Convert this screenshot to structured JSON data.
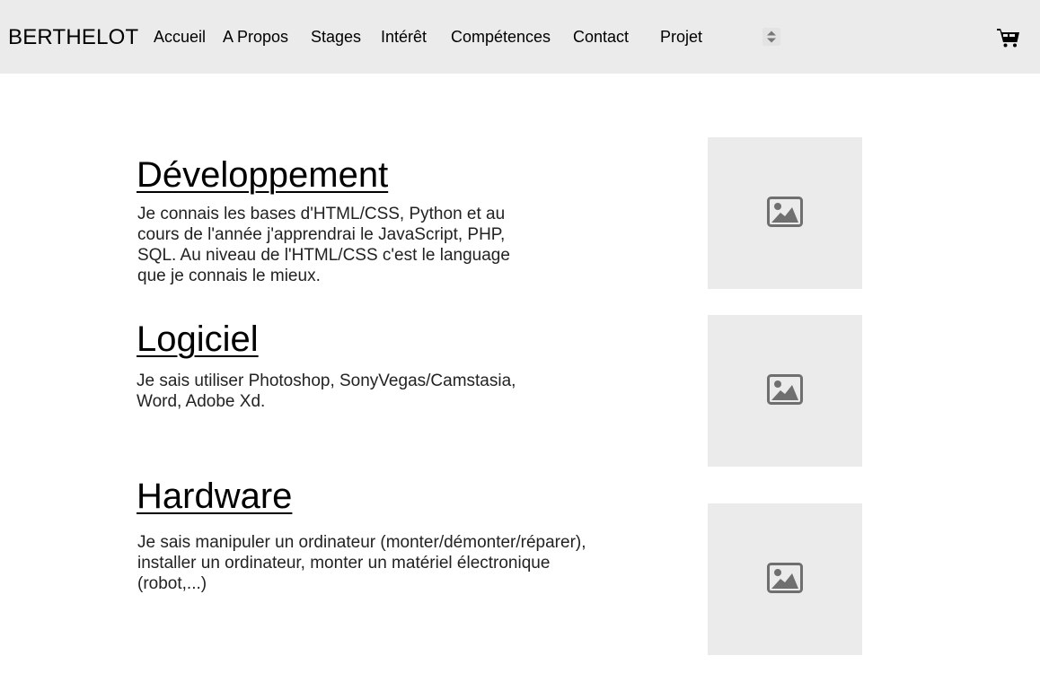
{
  "navbar": {
    "brand": "BERTHELOT",
    "links": [
      "Accueil",
      "A Propos",
      "Stages",
      "Intérêt",
      "Compétences",
      "Contact",
      "Projet"
    ],
    "select_icon": "up-down-arrows-icon",
    "cart_icon": "cart-icon"
  },
  "sections": [
    {
      "title": "Développement",
      "text": "Je connais les bases d'HTML/CSS, Python et au cours de l'année j'apprendrai le JavaScript, PHP, SQL. Au niveau de l'HTML/CSS c'est le language que je connais le mieux.",
      "image_icon": "image-placeholder-icon"
    },
    {
      "title": "Logiciel",
      "text": "Je sais utiliser Photoshop, SonyVegas/Camstasia, Word, Adobe Xd.",
      "image_icon": "image-placeholder-icon"
    },
    {
      "title": "Hardware",
      "text": "Je sais manipuler un ordinateur (monter/démonter/réparer), installer un ordinateur, monter un matériel électronique (robot,...)",
      "image_icon": "image-placeholder-icon"
    }
  ],
  "colors": {
    "navbar_bg": "#ebebeb",
    "placeholder_bg": "#ebebeb",
    "icon_gray": "#6f6f6f",
    "body_text": "#222222"
  }
}
